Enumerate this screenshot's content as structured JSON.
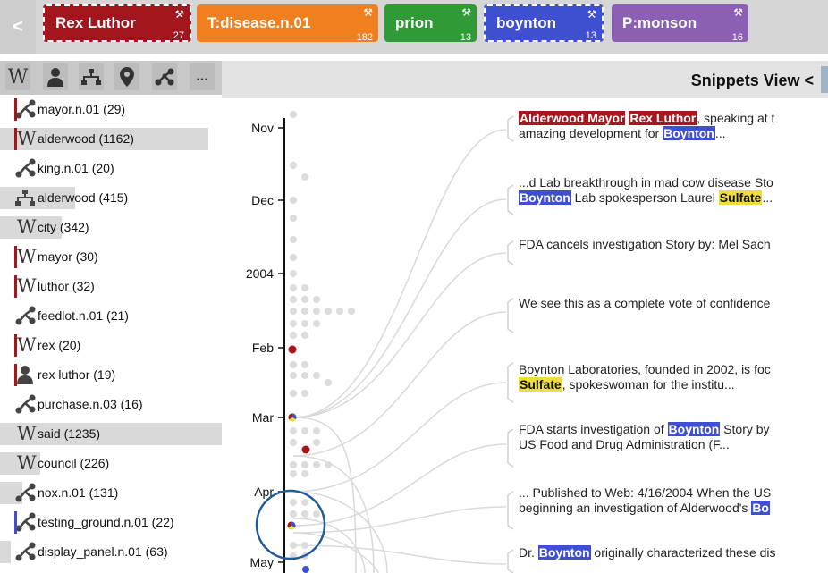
{
  "topbar": {
    "back_label": "<",
    "chips": [
      {
        "label": "Rex Luthor",
        "count": "27",
        "color": "#a3161e",
        "style": "dashed"
      },
      {
        "label": "T:disease.n.01",
        "count": "182",
        "color": "#ef7f1f",
        "style": "solid"
      },
      {
        "label": "prion",
        "count": "13",
        "color": "#2f9a36",
        "style": "solid"
      },
      {
        "label": "boynton",
        "count": "13",
        "color": "#3f4fd1",
        "style": "dashed"
      },
      {
        "label": "P:monson",
        "count": "16",
        "color": "#8a5fb4",
        "style": "solid"
      }
    ],
    "tool_glyph": "⚒"
  },
  "left_panel": {
    "wiki_glyph": "W",
    "more_label": "...",
    "terms": [
      {
        "label": "mayor.n.01 (29)",
        "type": "tree",
        "bar": 0.0,
        "mark": "#a3161e"
      },
      {
        "label": "alderwood (1162)",
        "type": "wiki",
        "bar": 0.94,
        "mark": "#a3161e"
      },
      {
        "label": "king.n.01 (20)",
        "type": "tree",
        "bar": 0.0,
        "mark": ""
      },
      {
        "label": "alderwood (415)",
        "type": "org",
        "bar": 0.34,
        "mark": ""
      },
      {
        "label": "city (342)",
        "type": "wiki",
        "bar": 0.28,
        "mark": ""
      },
      {
        "label": "mayor (30)",
        "type": "wiki",
        "bar": 0.0,
        "mark": "#a3161e"
      },
      {
        "label": "luthor (32)",
        "type": "wiki",
        "bar": 0.0,
        "mark": "#a3161e"
      },
      {
        "label": "feedlot.n.01 (21)",
        "type": "tree",
        "bar": 0.0,
        "mark": ""
      },
      {
        "label": "rex (20)",
        "type": "wiki",
        "bar": 0.0,
        "mark": "#a3161e"
      },
      {
        "label": "rex luthor (19)",
        "type": "person",
        "bar": 0.0,
        "mark": "#a3161e"
      },
      {
        "label": "purchase.n.03 (16)",
        "type": "tree",
        "bar": 0.0,
        "mark": ""
      },
      {
        "label": "said (1235)",
        "type": "wiki",
        "bar": 1.0,
        "mark": ""
      },
      {
        "label": "council (226)",
        "type": "wiki",
        "bar": 0.18,
        "mark": ""
      },
      {
        "label": "nox.n.01 (131)",
        "type": "tree",
        "bar": 0.1,
        "mark": ""
      },
      {
        "label": "testing_ground.n.01 (22)",
        "type": "tree",
        "bar": 0.0,
        "mark": "#3f4fd1"
      },
      {
        "label": "display_panel.n.01 (63)",
        "type": "tree",
        "bar": 0.05,
        "mark": ""
      }
    ]
  },
  "main": {
    "title": "Snippets View <",
    "timeline": {
      "labels": [
        "Nov",
        "Dec",
        "2004",
        "Feb",
        "Mar",
        "Apr",
        "May"
      ]
    },
    "snippets": [
      {
        "lines": [
          [
            {
              "t": "Alderwood Mayor",
              "h": "red"
            },
            {
              "t": " ",
              "h": ""
            },
            {
              "t": "Rex Luthor",
              "h": "red"
            },
            {
              "t": ", speaking at t",
              "h": ""
            }
          ],
          [
            {
              "t": "amazing development for ",
              "h": ""
            },
            {
              "t": "Boynton",
              "h": "blue"
            },
            {
              "t": "...",
              "h": ""
            }
          ]
        ]
      },
      {
        "lines": [
          [
            {
              "t": "...d Lab breakthrough in mad cow disease Sto",
              "h": ""
            }
          ],
          [
            {
              "t": "Boynton",
              "h": "blue"
            },
            {
              "t": " Lab spokesperson Laurel ",
              "h": ""
            },
            {
              "t": "Sulfate",
              "h": "yel"
            },
            {
              "t": "...",
              "h": ""
            }
          ]
        ]
      },
      {
        "lines": [
          [
            {
              "t": "FDA cancels investigation Story by: Mel Sach",
              "h": ""
            }
          ]
        ]
      },
      {
        "lines": [
          [
            {
              "t": "We see this as a complete vote of confidence",
              "h": ""
            }
          ]
        ]
      },
      {
        "lines": [
          [
            {
              "t": "Boynton Laboratories, founded in 2002, is foc",
              "h": ""
            }
          ],
          [
            {
              "t": "Sulfate",
              "h": "yel"
            },
            {
              "t": ", spokeswoman for the institu...",
              "h": ""
            }
          ]
        ]
      },
      {
        "lines": [
          [
            {
              "t": "FDA starts investigation of ",
              "h": ""
            },
            {
              "t": "Boynton",
              "h": "blue"
            },
            {
              "t": " Story by",
              "h": ""
            }
          ],
          [
            {
              "t": "US Food and Drug Administration (F...",
              "h": ""
            }
          ]
        ]
      },
      {
        "lines": [
          [
            {
              "t": "... Published to Web: 4/16/2004 When the US",
              "h": ""
            }
          ],
          [
            {
              "t": "beginning an investigation of Alderwood's ",
              "h": ""
            },
            {
              "t": "Bo",
              "h": "blue"
            }
          ]
        ]
      },
      {
        "lines": [
          [
            {
              "t": "Dr. ",
              "h": ""
            },
            {
              "t": "Boynton",
              "h": "blue"
            },
            {
              "t": " originally characterized these dis",
              "h": ""
            }
          ]
        ]
      }
    ]
  },
  "colors": {
    "red": "#a3161e",
    "blue": "#3f4fd1",
    "yellow": "#f0dc3a",
    "gray_dot": "#d8d8d8",
    "highlight_circle": "#1f5a99"
  }
}
